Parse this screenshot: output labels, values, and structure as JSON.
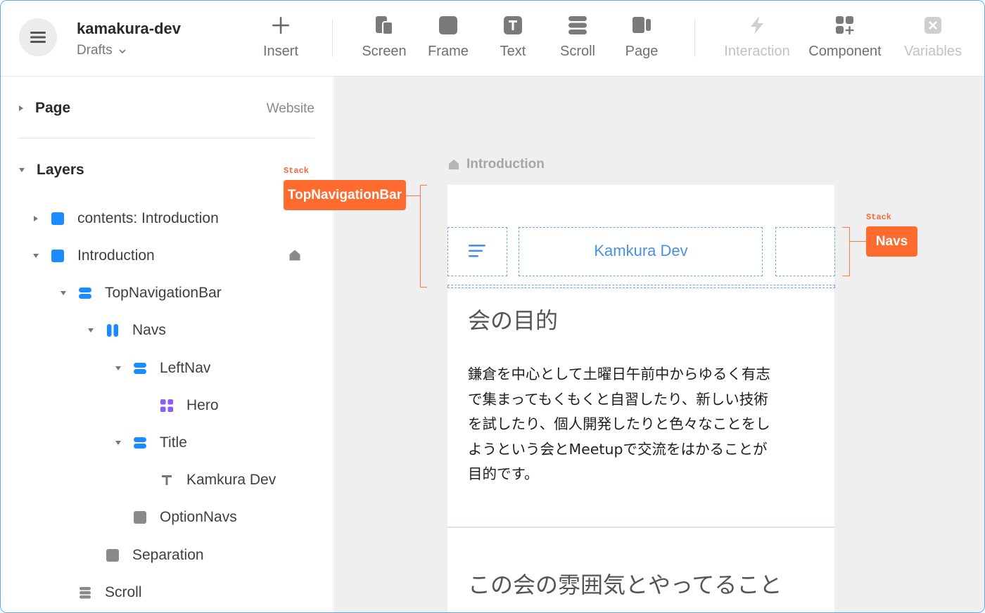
{
  "header": {
    "project_name": "kamakura-dev",
    "drafts_label": "Drafts",
    "tools": [
      {
        "label": "Insert",
        "icon": "plus-icon",
        "enabled": true
      },
      {
        "label": "Screen",
        "icon": "screen-icon",
        "enabled": true
      },
      {
        "label": "Frame",
        "icon": "frame-icon",
        "enabled": true
      },
      {
        "label": "Text",
        "icon": "text-icon",
        "enabled": true
      },
      {
        "label": "Scroll",
        "icon": "scroll-icon",
        "enabled": true
      },
      {
        "label": "Page",
        "icon": "page-icon",
        "enabled": true
      },
      {
        "label": "Interaction",
        "icon": "bolt-icon",
        "enabled": false
      },
      {
        "label": "Component",
        "icon": "component-icon",
        "enabled": true
      },
      {
        "label": "Variables",
        "icon": "variables-icon",
        "enabled": false
      }
    ]
  },
  "sidebar": {
    "page_section": {
      "label": "Page",
      "value": "Website"
    },
    "layers_section": {
      "label": "Layers"
    },
    "layers": [
      {
        "label": "contents: Introduction",
        "icon": "frame-icon",
        "expanded": false
      },
      {
        "label": "Introduction",
        "icon": "frame-icon",
        "expanded": true,
        "home": true
      },
      {
        "label": "TopNavigationBar",
        "icon": "stack-icon",
        "expanded": true
      },
      {
        "label": "Navs",
        "icon": "columns-icon",
        "expanded": true
      },
      {
        "label": "LeftNav",
        "icon": "stack-icon",
        "expanded": true
      },
      {
        "label": "Hero",
        "icon": "component-icon",
        "expanded": null
      },
      {
        "label": "Title",
        "icon": "stack-icon",
        "expanded": true
      },
      {
        "label": "Kamkura Dev",
        "icon": "text-icon",
        "expanded": null
      },
      {
        "label": "OptionNavs",
        "icon": "frame-icon",
        "expanded": null
      },
      {
        "label": "Separation",
        "icon": "frame-icon",
        "expanded": null
      },
      {
        "label": "Scroll",
        "icon": "scroll-icon",
        "expanded": null
      }
    ]
  },
  "canvas": {
    "screen_label": "Introduction",
    "top_nav_tag": {
      "type": "Stack",
      "name": "TopNavigationBar"
    },
    "navs_tag": {
      "type": "Stack",
      "name": "Navs"
    },
    "title_text": "Kamkura Dev",
    "heading1": "会の目的",
    "body_lines": [
      "鎌倉を中心として土曜日午前中からゆるく有志",
      "で集まってもくもくと自習したり、新しい技術",
      "を試したり、個人開発したりと色々なことをし",
      "ようという会とMeetupで交流をはかることが",
      "目的です。"
    ],
    "heading2": "この会の雰囲気とやってること"
  },
  "colors": {
    "accent_blue": "#1a8cff",
    "tag_orange": "#ff6a2f",
    "component_purple": "#8b5cf6"
  }
}
